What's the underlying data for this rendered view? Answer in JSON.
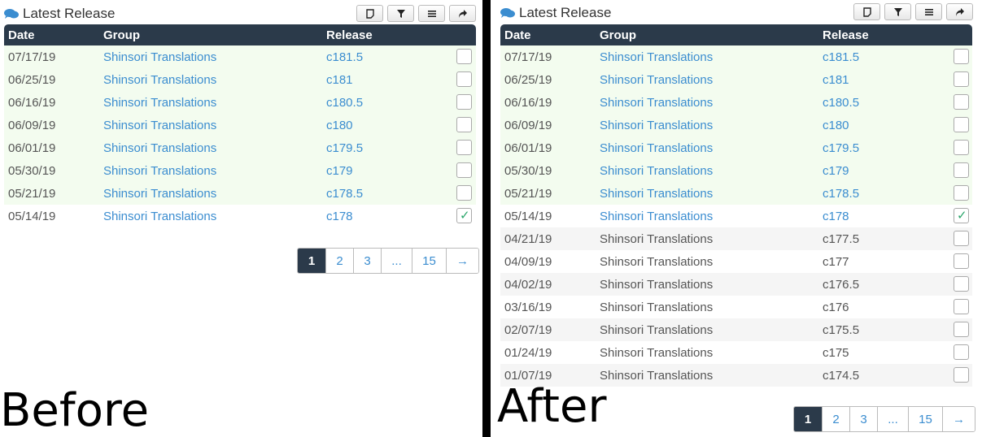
{
  "panel": {
    "title": "Latest Release",
    "columns": {
      "date": "Date",
      "group": "Group",
      "release": "Release"
    }
  },
  "before": {
    "caption": "Before",
    "rows": [
      {
        "date": "07/17/19",
        "group": "Shinsori Translations",
        "release": "c181.5",
        "checked": false
      },
      {
        "date": "06/25/19",
        "group": "Shinsori Translations",
        "release": "c181",
        "checked": false
      },
      {
        "date": "06/16/19",
        "group": "Shinsori Translations",
        "release": "c180.5",
        "checked": false
      },
      {
        "date": "06/09/19",
        "group": "Shinsori Translations",
        "release": "c180",
        "checked": false
      },
      {
        "date": "06/01/19",
        "group": "Shinsori Translations",
        "release": "c179.5",
        "checked": false
      },
      {
        "date": "05/30/19",
        "group": "Shinsori Translations",
        "release": "c179",
        "checked": false
      },
      {
        "date": "05/21/19",
        "group": "Shinsori Translations",
        "release": "c178.5",
        "checked": false
      },
      {
        "date": "05/14/19",
        "group": "Shinsori Translations",
        "release": "c178",
        "checked": true
      }
    ]
  },
  "after": {
    "caption": "After",
    "rows": [
      {
        "date": "07/17/19",
        "group": "Shinsori Translations",
        "release": "c181.5",
        "checked": false
      },
      {
        "date": "06/25/19",
        "group": "Shinsori Translations",
        "release": "c181",
        "checked": false
      },
      {
        "date": "06/16/19",
        "group": "Shinsori Translations",
        "release": "c180.5",
        "checked": false
      },
      {
        "date": "06/09/19",
        "group": "Shinsori Translations",
        "release": "c180",
        "checked": false
      },
      {
        "date": "06/01/19",
        "group": "Shinsori Translations",
        "release": "c179.5",
        "checked": false
      },
      {
        "date": "05/30/19",
        "group": "Shinsori Translations",
        "release": "c179",
        "checked": false
      },
      {
        "date": "05/21/19",
        "group": "Shinsori Translations",
        "release": "c178.5",
        "checked": false
      },
      {
        "date": "05/14/19",
        "group": "Shinsori Translations",
        "release": "c178",
        "checked": true
      },
      {
        "date": "04/21/19",
        "group": "Shinsori Translations",
        "release": "c177.5",
        "checked": false
      },
      {
        "date": "04/09/19",
        "group": "Shinsori Translations",
        "release": "c177",
        "checked": false
      },
      {
        "date": "04/02/19",
        "group": "Shinsori Translations",
        "release": "c176.5",
        "checked": false
      },
      {
        "date": "03/16/19",
        "group": "Shinsori Translations",
        "release": "c176",
        "checked": false
      },
      {
        "date": "02/07/19",
        "group": "Shinsori Translations",
        "release": "c175.5",
        "checked": false
      },
      {
        "date": "01/24/19",
        "group": "Shinsori Translations",
        "release": "c175",
        "checked": false
      },
      {
        "date": "01/07/19",
        "group": "Shinsori Translations",
        "release": "c174.5",
        "checked": false
      }
    ]
  },
  "pagination": [
    "1",
    "2",
    "3",
    "...",
    "15",
    "→"
  ],
  "colors": {
    "header": "#2b3a4a",
    "link": "#3b8dd0",
    "new_row": "#f3fcef"
  }
}
